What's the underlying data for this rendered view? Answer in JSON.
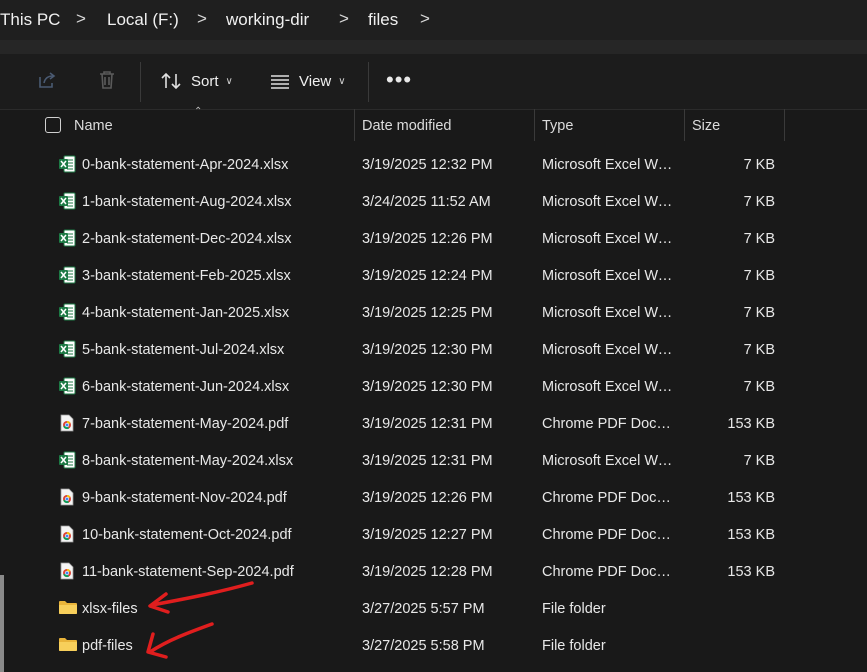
{
  "breadcrumb": {
    "items": [
      "This PC",
      "Local (F:)",
      "working-dir",
      "files"
    ],
    "separator": ">"
  },
  "toolbar": {
    "share_icon": "share-icon",
    "delete_icon": "trash-icon",
    "sort_label": "Sort",
    "view_label": "View",
    "more_label": "•••"
  },
  "columns": {
    "name": "Name",
    "date": "Date modified",
    "type": "Type",
    "size": "Size"
  },
  "files": [
    {
      "name": "0-bank-statement-Apr-2024.xlsx",
      "date": "3/19/2025 12:32 PM",
      "type": "Microsoft Excel Worksheet",
      "size": "7 KB",
      "icon": "excel"
    },
    {
      "name": "1-bank-statement-Aug-2024.xlsx",
      "date": "3/24/2025 11:52 AM",
      "type": "Microsoft Excel Worksheet",
      "size": "7 KB",
      "icon": "excel"
    },
    {
      "name": "2-bank-statement-Dec-2024.xlsx",
      "date": "3/19/2025 12:26 PM",
      "type": "Microsoft Excel Worksheet",
      "size": "7 KB",
      "icon": "excel"
    },
    {
      "name": "3-bank-statement-Feb-2025.xlsx",
      "date": "3/19/2025 12:24 PM",
      "type": "Microsoft Excel Worksheet",
      "size": "7 KB",
      "icon": "excel"
    },
    {
      "name": "4-bank-statement-Jan-2025.xlsx",
      "date": "3/19/2025 12:25 PM",
      "type": "Microsoft Excel Worksheet",
      "size": "7 KB",
      "icon": "excel"
    },
    {
      "name": "5-bank-statement-Jul-2024.xlsx",
      "date": "3/19/2025 12:30 PM",
      "type": "Microsoft Excel Worksheet",
      "size": "7 KB",
      "icon": "excel"
    },
    {
      "name": "6-bank-statement-Jun-2024.xlsx",
      "date": "3/19/2025 12:30 PM",
      "type": "Microsoft Excel Worksheet",
      "size": "7 KB",
      "icon": "excel"
    },
    {
      "name": "7-bank-statement-May-2024.pdf",
      "date": "3/19/2025 12:31 PM",
      "type": "Chrome PDF Document",
      "size": "153 KB",
      "icon": "pdf"
    },
    {
      "name": "8-bank-statement-May-2024.xlsx",
      "date": "3/19/2025 12:31 PM",
      "type": "Microsoft Excel Worksheet",
      "size": "7 KB",
      "icon": "excel"
    },
    {
      "name": "9-bank-statement-Nov-2024.pdf",
      "date": "3/19/2025 12:26 PM",
      "type": "Chrome PDF Document",
      "size": "153 KB",
      "icon": "pdf"
    },
    {
      "name": "10-bank-statement-Oct-2024.pdf",
      "date": "3/19/2025 12:27 PM",
      "type": "Chrome PDF Document",
      "size": "153 KB",
      "icon": "pdf"
    },
    {
      "name": "11-bank-statement-Sep-2024.pdf",
      "date": "3/19/2025 12:28 PM",
      "type": "Chrome PDF Document",
      "size": "153 KB",
      "icon": "pdf"
    },
    {
      "name": "xlsx-files",
      "date": "3/27/2025 5:57 PM",
      "type": "File folder",
      "size": "",
      "icon": "folder"
    },
    {
      "name": "pdf-files",
      "date": "3/27/2025 5:58 PM",
      "type": "File folder",
      "size": "",
      "icon": "folder"
    }
  ],
  "colors": {
    "background": "#191919",
    "excel_green": "#1d7a45",
    "folder_yellow": "#f3c443",
    "annotation_red": "#e01e1e"
  }
}
